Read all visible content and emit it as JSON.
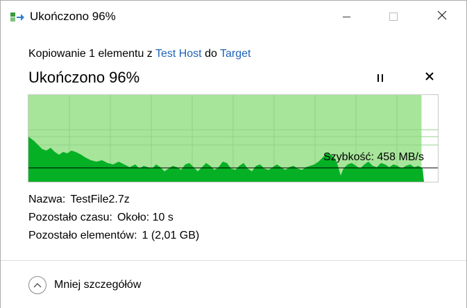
{
  "window": {
    "title": "Ukończono 96%",
    "controls": {
      "minimize": "minimize-icon",
      "maximize": "maximize-icon",
      "close": "close-icon"
    }
  },
  "copy": {
    "prefix": "Kopiowanie 1 elementu z ",
    "source": "Test Host",
    "middle": " do ",
    "destination": "Target"
  },
  "progress": {
    "title": "Ukończono 96%",
    "percent": 96,
    "pause_icon": "pause-icon",
    "cancel_icon": "cancel-icon"
  },
  "graph": {
    "speed_text": "Szybkość: 458 MB/s",
    "fill_color": "#06b025",
    "bg_fill_color": "#a7e59b",
    "line_color": "#000000"
  },
  "details": {
    "name_label": "Nazwa:",
    "name_value": "TestFile2.7z",
    "time_label": "Pozostało czasu:",
    "time_value": "Około: 10 s",
    "items_label": "Pozostało elementów:",
    "items_value": "1 (2,01 GB)"
  },
  "footer": {
    "less_details_label": "Mniej szczegółów",
    "icon": "chevron-up-icon"
  }
}
